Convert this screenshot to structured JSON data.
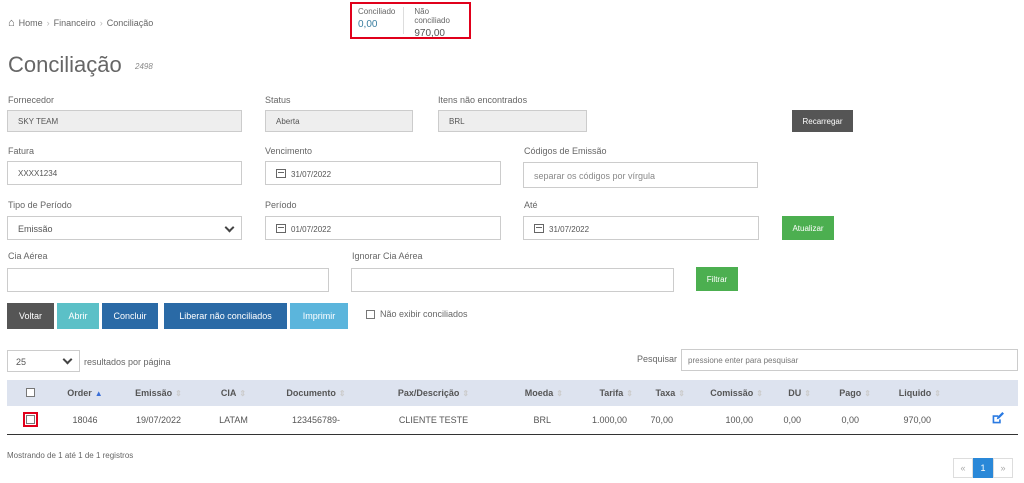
{
  "breadcrumb": {
    "home": "Home",
    "financeiro": "Financeiro",
    "current": "Conciliação"
  },
  "summary": {
    "conciliado_label": "Conciliado",
    "conciliado_value": "0,00",
    "nao_label": "Não conciliado",
    "nao_value": "970,00"
  },
  "page": {
    "title": "Conciliação",
    "id": "2498"
  },
  "fields": {
    "fornecedor_label": "Fornecedor",
    "fornecedor_value": "SKY TEAM",
    "status_label": "Status",
    "status_value": "Aberta",
    "itens_label": "Itens não encontrados",
    "itens_value": "BRL",
    "recarregar": "Recarregar",
    "fatura_label": "Fatura",
    "fatura_value": "XXXX1234",
    "vencimento_label": "Vencimento",
    "vencimento_value": "31/07/2022",
    "codigos_label": "Códigos de Emissão",
    "codigos_placeholder": "separar os códigos por vírgula",
    "tipo_label": "Tipo de Período",
    "tipo_value": "Emissão",
    "periodo_label": "Período",
    "periodo_value": "01/07/2022",
    "ate_label": "Até",
    "ate_value": "31/07/2022",
    "atualizar": "Atualizar",
    "cia_label": "Cia Aérea",
    "ignorar_label": "Ignorar Cia Aérea",
    "filtrar": "Filtrar"
  },
  "actions": {
    "voltar": "Voltar",
    "abrir": "Abrir",
    "concluir": "Concluir",
    "liberar": "Liberar não conciliados",
    "imprimir": "Imprimir",
    "nao_exibir": "Não exibir conciliados"
  },
  "table_controls": {
    "page_size": "25",
    "per_page_label": "resultados por página",
    "search_label": "Pesquisar",
    "search_placeholder": "pressione enter para pesquisar"
  },
  "table": {
    "headers": [
      "Order",
      "Emissão",
      "CIA",
      "Documento",
      "Pax/Descrição",
      "Moeda",
      "Tarifa",
      "Taxa",
      "Comissão",
      "DU",
      "Pago",
      "Liquido"
    ],
    "rows": [
      {
        "order": "18046",
        "emissao": "19/07/2022",
        "cia": "LATAM",
        "documento": "123456789-",
        "pax": "CLIENTE TESTE",
        "moeda": "BRL",
        "tarifa": "1.000,00",
        "taxa": "70,00",
        "comissao": "100,00",
        "du": "0,00",
        "pago": "0,00",
        "liquido": "970,00"
      }
    ]
  },
  "footer": {
    "info": "Mostrando de 1 até 1 de 1 registros",
    "prev": "«",
    "page": "1",
    "next": "»"
  },
  "colors": {
    "accent_blue": "#2a6aa6",
    "green": "#4caf50",
    "highlight_red": "#e0001b"
  }
}
